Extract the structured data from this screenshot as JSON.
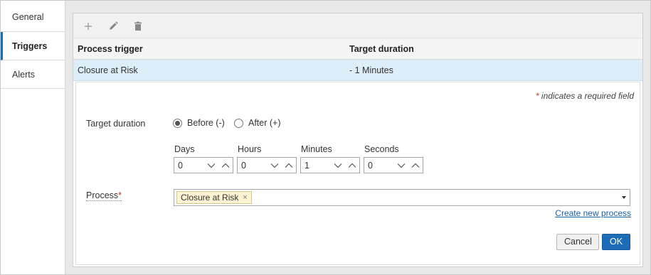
{
  "sidebar": {
    "items": [
      {
        "label": "General"
      },
      {
        "label": "Triggers"
      },
      {
        "label": "Alerts"
      }
    ]
  },
  "toolbar": {
    "add_icon": "plus-icon",
    "edit_icon": "pencil-icon",
    "delete_icon": "trash-icon"
  },
  "table": {
    "columns": [
      "Process trigger",
      "Target duration"
    ],
    "rows": [
      {
        "process_trigger": "Closure at Risk",
        "target_duration": "- 1 Minutes"
      }
    ]
  },
  "form": {
    "required_note_star": "*",
    "required_note_text": " indicates a required field",
    "target_duration_label": "Target duration",
    "radio_before": "Before (-)",
    "radio_after": "After (+)",
    "selected": "before",
    "spinners": [
      {
        "label": "Days",
        "value": "0"
      },
      {
        "label": "Hours",
        "value": "0"
      },
      {
        "label": "Minutes",
        "value": "1"
      },
      {
        "label": "Seconds",
        "value": "0"
      }
    ],
    "process_label": "Process",
    "process_star": "*",
    "process_chip": "Closure at Risk",
    "chip_remove": "×",
    "create_link": "Create new process",
    "cancel_label": "Cancel",
    "ok_label": "OK"
  },
  "colors": {
    "accent": "#1e6bb8",
    "selected_row": "#ddeef8",
    "chip_bg": "#fdf3d2",
    "required_star": "#c0392b"
  }
}
